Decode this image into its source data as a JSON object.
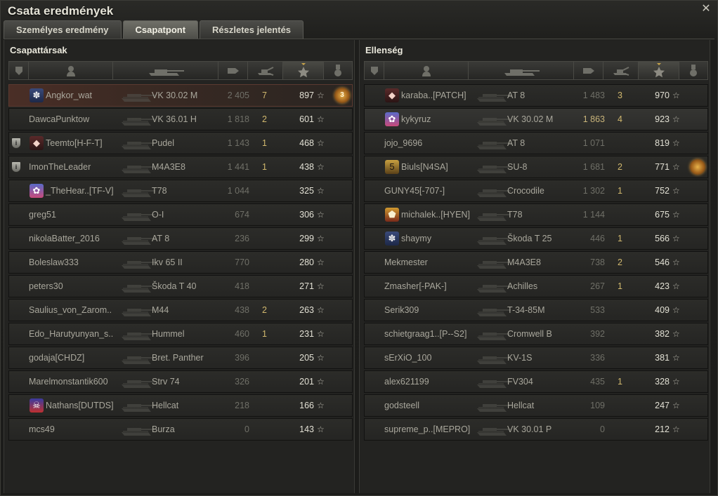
{
  "window": {
    "title": "Csata eredmények",
    "close_icon": "close-icon"
  },
  "tabs": [
    {
      "label": "Személyes eredmény",
      "active": false
    },
    {
      "label": "Csapatpont",
      "active": true
    },
    {
      "label": "Részletes jelentés",
      "active": false
    }
  ],
  "columns": {
    "icons": [
      "badge-column-icon",
      "player-column-icon",
      "vehicle-column-icon",
      "damage-column-icon",
      "frags-column-icon",
      "xp-star-column-icon",
      "medal-column-icon"
    ],
    "sorted_by": "xp"
  },
  "colors": {
    "self_row": "#4a2e26",
    "frags": "#d1b86e",
    "damage_highlight": "#c8b47a",
    "medal": "#e8b24a"
  },
  "teams": [
    {
      "title": "Csapattársak",
      "players": [
        {
          "name": "Angkor_wat",
          "clan_icon": "edelweiss",
          "vehicle": "VK 30.02 M",
          "damage": "2 405",
          "frags": "7",
          "xp": "897",
          "medal": "3",
          "self": true
        },
        {
          "name": "DawcaPunktow",
          "vehicle": "VK 36.01 H",
          "damage": "1 818",
          "frags": "2",
          "xp": "601"
        },
        {
          "name": "Teemto[H-F-T]",
          "badge": "i",
          "clan_icon": "diamond",
          "vehicle": "Pudel",
          "damage": "1 143",
          "frags": "1",
          "xp": "468"
        },
        {
          "name": "ImonTheLeader",
          "badge": "i",
          "vehicle": "M4A3E8",
          "damage": "1 441",
          "frags": "1",
          "xp": "438"
        },
        {
          "name": "_TheHear..[TF-V]",
          "clan_icon": "flower",
          "vehicle": "T78",
          "damage": "1 044",
          "frags": "",
          "xp": "325"
        },
        {
          "name": "greg51",
          "vehicle": "O-I",
          "damage": "674",
          "frags": "",
          "xp": "306"
        },
        {
          "name": "nikolaBatter_2016",
          "vehicle": "AT 8",
          "damage": "236",
          "frags": "",
          "xp": "299"
        },
        {
          "name": "Boleslaw333",
          "vehicle": "Ikv 65 II",
          "damage": "770",
          "frags": "",
          "xp": "280"
        },
        {
          "name": "peters30",
          "vehicle": "Škoda T 40",
          "damage": "418",
          "frags": "",
          "xp": "271"
        },
        {
          "name": "Saulius_von_Zarom..",
          "vehicle": "M44",
          "damage": "438",
          "frags": "2",
          "xp": "263"
        },
        {
          "name": "Edo_Harutyunyan_s..",
          "vehicle": "Hummel",
          "damage": "460",
          "frags": "1",
          "xp": "231"
        },
        {
          "name": "godaja[CHDZ]",
          "vehicle": "Bret. Panther",
          "damage": "396",
          "frags": "",
          "xp": "205"
        },
        {
          "name": "Marelmonstantik600",
          "vehicle": "Strv 74",
          "damage": "326",
          "frags": "",
          "xp": "201"
        },
        {
          "name": "Nathans[DUTDS]",
          "clan_icon": "skull",
          "vehicle": "Hellcat",
          "damage": "218",
          "frags": "",
          "xp": "166"
        },
        {
          "name": "mcs49",
          "vehicle": "Burza",
          "damage": "0",
          "frags": "",
          "xp": "143"
        }
      ]
    },
    {
      "title": "Ellenség",
      "players": [
        {
          "name": "karaba..[PATCH]",
          "clan_icon": "diamond",
          "vehicle": "AT 8",
          "damage": "1 483",
          "frags": "3",
          "xp": "970"
        },
        {
          "name": "kykyruz",
          "clan_icon": "flower",
          "vehicle": "VK 30.02 M",
          "damage": "1 863",
          "frags": "4",
          "xp": "923",
          "friend": true,
          "damage_hi": true
        },
        {
          "name": "jojo_9696",
          "vehicle": "AT 8",
          "damage": "1 071",
          "frags": "",
          "xp": "819"
        },
        {
          "name": "Biuls[N4SA]",
          "clan_icon": "five",
          "vehicle": "SU-8",
          "damage": "1 681",
          "frags": "2",
          "xp": "771",
          "medal": ""
        },
        {
          "name": "GUNY45[-707-]",
          "vehicle": "Crocodile",
          "damage": "1 302",
          "frags": "1",
          "xp": "752"
        },
        {
          "name": "michalek..[HYEN]",
          "clan_icon": "pentagon",
          "vehicle": "T78",
          "damage": "1 144",
          "frags": "",
          "xp": "675"
        },
        {
          "name": "shaymy",
          "clan_icon": "edelweiss",
          "vehicle": "Škoda T 25",
          "damage": "446",
          "frags": "1",
          "xp": "566"
        },
        {
          "name": "Mekmester",
          "vehicle": "M4A3E8",
          "damage": "738",
          "frags": "2",
          "xp": "546"
        },
        {
          "name": "Zmasher[-PAK-]",
          "vehicle": "Achilles",
          "damage": "267",
          "frags": "1",
          "xp": "423"
        },
        {
          "name": "Serik309",
          "vehicle": "T-34-85M",
          "damage": "533",
          "frags": "",
          "xp": "409"
        },
        {
          "name": "schietgraag1..[P--S2]",
          "vehicle": "Cromwell B",
          "damage": "392",
          "frags": "",
          "xp": "382"
        },
        {
          "name": "sErXiO_100",
          "vehicle": "KV-1S",
          "damage": "336",
          "frags": "",
          "xp": "381"
        },
        {
          "name": "alex621199",
          "vehicle": "FV304",
          "damage": "435",
          "frags": "1",
          "xp": "328"
        },
        {
          "name": "godsteell",
          "vehicle": "Hellcat",
          "damage": "109",
          "frags": "",
          "xp": "247"
        },
        {
          "name": "supreme_p..[MEPRO]",
          "vehicle": "VK 30.01 P",
          "damage": "0",
          "frags": "",
          "xp": "212"
        }
      ]
    }
  ]
}
